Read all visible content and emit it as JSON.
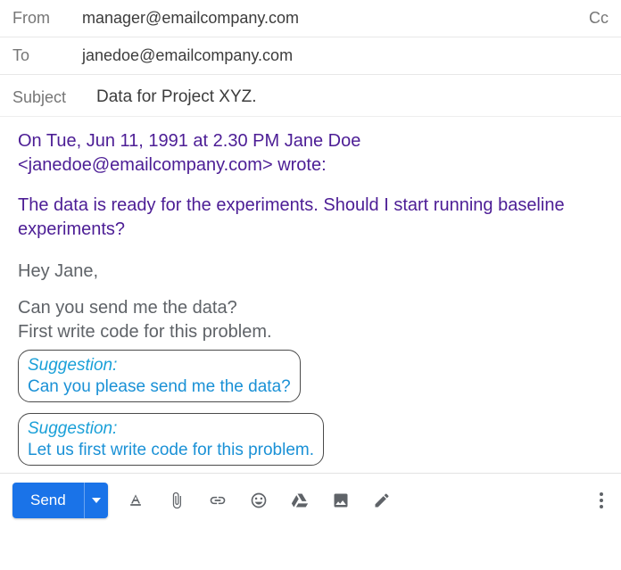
{
  "header": {
    "from_label": "From",
    "from_value": "manager@emailcompany.com",
    "cc_label": "Cc",
    "to_label": "To",
    "to_value": "janedoe@emailcompany.com",
    "subject_label": "Subject",
    "subject_value": "Data for Project XYZ."
  },
  "body": {
    "quoted_header": "On Tue, Jun 11, 1991 at 2.30 PM Jane Doe <janedoe@emailcompany.com> wrote:",
    "quoted_message": "The data is ready for the experiments. Should I start running baseline experiments?",
    "reply_greeting": "Hey Jane,",
    "reply_line1": "Can you send me the data?",
    "reply_line2": "First write code for this problem.",
    "suggestion_label": "Suggestion:",
    "suggestion1": "Can you please send me the data?",
    "suggestion2": "Let us first write code for this problem."
  },
  "toolbar": {
    "send_label": "Send"
  }
}
